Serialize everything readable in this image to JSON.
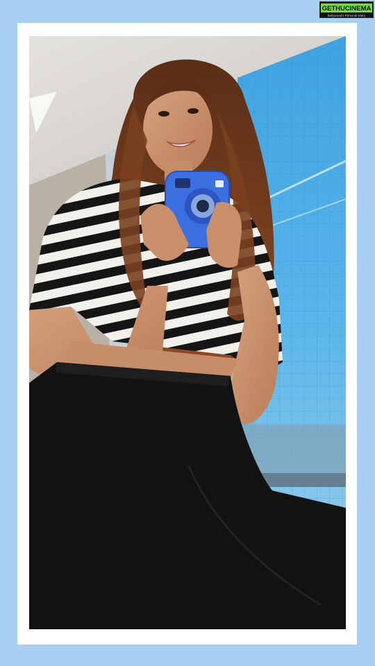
{
  "watermark": {
    "text": "GETHUCINEMA",
    "tagline": "Bollywood's Personal Diary"
  },
  "colors": {
    "background": "#a9d0f3",
    "frame": "#ffffff",
    "camera": "#3b6fe0",
    "logo_green": "#6fe03a"
  },
  "photo": {
    "subject": "woman holding instant camera"
  }
}
